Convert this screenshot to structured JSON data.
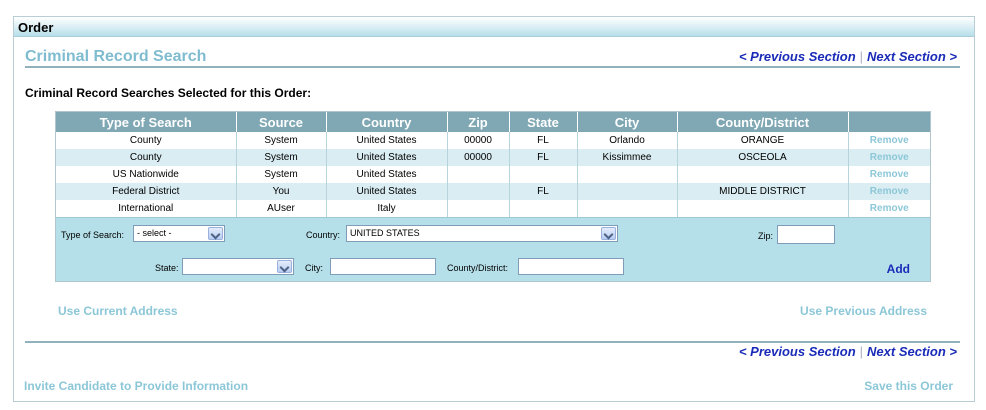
{
  "header": {
    "title": "Order"
  },
  "section": {
    "title": "Criminal Record Search",
    "prev_label": "< Previous Section",
    "separator": "|",
    "next_label": "Next Section >"
  },
  "subheading": "Criminal Record Searches Selected for this Order:",
  "table": {
    "columns": [
      "Type of Search",
      "Source",
      "Country",
      "Zip",
      "State",
      "City",
      "County/District",
      ""
    ],
    "remove_label": "Remove",
    "rows": [
      {
        "type": "County",
        "source": "System",
        "country": "United States",
        "zip": "00000",
        "state": "FL",
        "city": "Orlando",
        "county": "ORANGE"
      },
      {
        "type": "County",
        "source": "System",
        "country": "United States",
        "zip": "00000",
        "state": "FL",
        "city": "Kissimmee",
        "county": "OSCEOLA"
      },
      {
        "type": "US Nationwide",
        "source": "System",
        "country": "United States",
        "zip": "",
        "state": "",
        "city": "",
        "county": ""
      },
      {
        "type": "Federal District",
        "source": "You",
        "country": "United States",
        "zip": "",
        "state": "FL",
        "city": "",
        "county": "MIDDLE DISTRICT"
      },
      {
        "type": "International",
        "source": "AUser",
        "country": "Italy",
        "zip": "",
        "state": "",
        "city": "",
        "county": ""
      }
    ]
  },
  "form": {
    "type_label": "Type of Search:",
    "type_value": "- select -",
    "country_label": "Country:",
    "country_value": "UNITED STATES",
    "zip_label": "Zip:",
    "zip_value": "",
    "state_label": "State:",
    "state_value": "",
    "city_label": "City:",
    "city_value": "",
    "county_label": "County/District:",
    "county_value": "",
    "add_label": "Add"
  },
  "address": {
    "current_label": "Use Current Address",
    "previous_label": "Use Previous Address"
  },
  "footer": {
    "invite_label": "Invite Candidate to Provide Information",
    "save_label": "Save this Order"
  },
  "colors": {
    "header_bar": "#b7dfea",
    "section_title": "#7fbcd0",
    "nav_link": "#1a2bb8",
    "table_header": "#7fa7b4",
    "row_alt": "#d9edf2",
    "form_bg": "#b6e0e9",
    "muted_link": "#8cc7d8"
  }
}
